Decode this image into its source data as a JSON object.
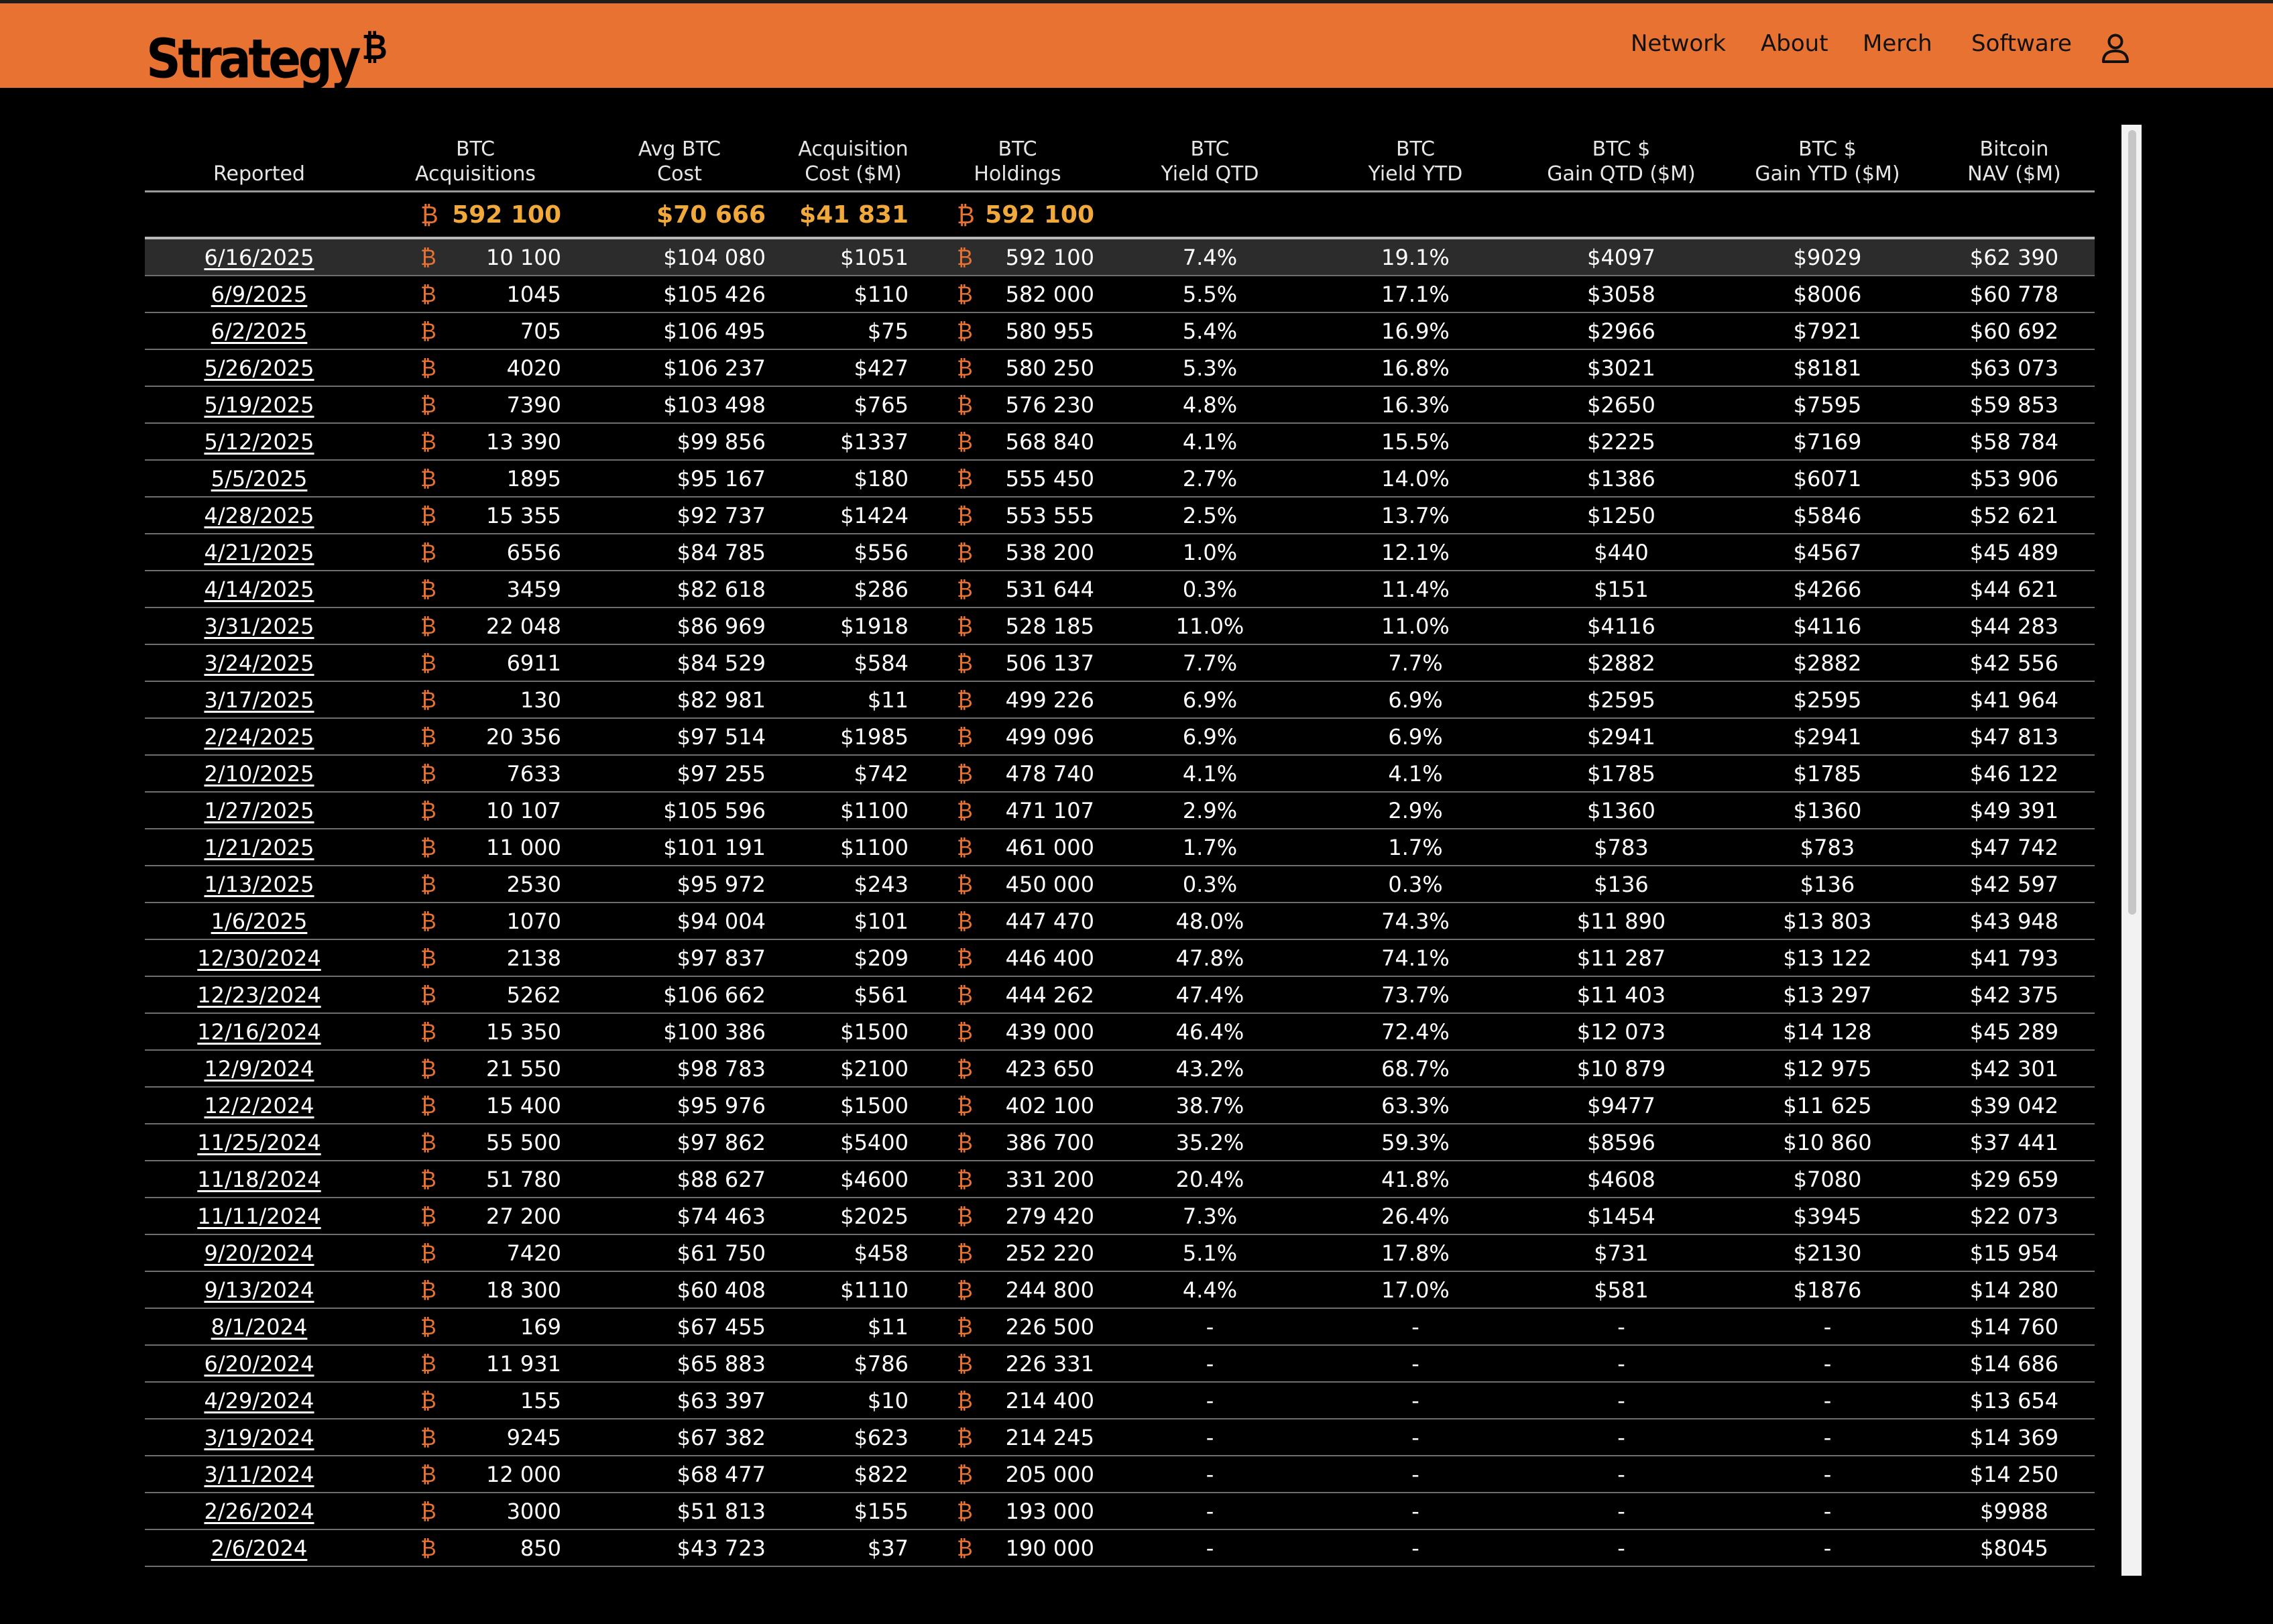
{
  "brand": {
    "name": "Strategy",
    "mark": "₿",
    "accent": "#E87232",
    "totals_color": "#F2A93B"
  },
  "nav": [
    "Network",
    "About",
    "Merch",
    "Software"
  ],
  "icons": {
    "user": "user-icon",
    "btc": "bitcoin-symbol"
  },
  "table": {
    "headers": [
      [
        "Reported"
      ],
      [
        "BTC",
        "Acquisitions"
      ],
      [
        "Avg BTC",
        "Cost"
      ],
      [
        "Acquisition",
        "Cost ($M)"
      ],
      [
        "BTC",
        "Holdings"
      ],
      [
        "BTC",
        "Yield QTD"
      ],
      [
        "BTC",
        "Yield YTD"
      ],
      [
        "BTC $",
        "Gain QTD ($M)"
      ],
      [
        "BTC $",
        "Gain YTD ($M)"
      ],
      [
        "Bitcoin",
        "NAV ($M)"
      ]
    ],
    "totals": {
      "acquisitions": "592 100",
      "avg_cost": "$70 666",
      "acq_cost": "$41 831",
      "holdings": "592 100"
    },
    "rows": [
      [
        "6/16/2025",
        "10 100",
        "$104 080",
        "$1051",
        "592 100",
        "7.4%",
        "19.1%",
        "$4097",
        "$9029",
        "$62 390"
      ],
      [
        "6/9/2025",
        "1045",
        "$105 426",
        "$110",
        "582 000",
        "5.5%",
        "17.1%",
        "$3058",
        "$8006",
        "$60 778"
      ],
      [
        "6/2/2025",
        "705",
        "$106 495",
        "$75",
        "580 955",
        "5.4%",
        "16.9%",
        "$2966",
        "$7921",
        "$60 692"
      ],
      [
        "5/26/2025",
        "4020",
        "$106 237",
        "$427",
        "580 250",
        "5.3%",
        "16.8%",
        "$3021",
        "$8181",
        "$63 073"
      ],
      [
        "5/19/2025",
        "7390",
        "$103 498",
        "$765",
        "576 230",
        "4.8%",
        "16.3%",
        "$2650",
        "$7595",
        "$59 853"
      ],
      [
        "5/12/2025",
        "13 390",
        "$99 856",
        "$1337",
        "568 840",
        "4.1%",
        "15.5%",
        "$2225",
        "$7169",
        "$58 784"
      ],
      [
        "5/5/2025",
        "1895",
        "$95 167",
        "$180",
        "555 450",
        "2.7%",
        "14.0%",
        "$1386",
        "$6071",
        "$53 906"
      ],
      [
        "4/28/2025",
        "15 355",
        "$92 737",
        "$1424",
        "553 555",
        "2.5%",
        "13.7%",
        "$1250",
        "$5846",
        "$52 621"
      ],
      [
        "4/21/2025",
        "6556",
        "$84 785",
        "$556",
        "538 200",
        "1.0%",
        "12.1%",
        "$440",
        "$4567",
        "$45 489"
      ],
      [
        "4/14/2025",
        "3459",
        "$82 618",
        "$286",
        "531 644",
        "0.3%",
        "11.4%",
        "$151",
        "$4266",
        "$44 621"
      ],
      [
        "3/31/2025",
        "22 048",
        "$86 969",
        "$1918",
        "528 185",
        "11.0%",
        "11.0%",
        "$4116",
        "$4116",
        "$44 283"
      ],
      [
        "3/24/2025",
        "6911",
        "$84 529",
        "$584",
        "506 137",
        "7.7%",
        "7.7%",
        "$2882",
        "$2882",
        "$42 556"
      ],
      [
        "3/17/2025",
        "130",
        "$82 981",
        "$11",
        "499 226",
        "6.9%",
        "6.9%",
        "$2595",
        "$2595",
        "$41 964"
      ],
      [
        "2/24/2025",
        "20 356",
        "$97 514",
        "$1985",
        "499 096",
        "6.9%",
        "6.9%",
        "$2941",
        "$2941",
        "$47 813"
      ],
      [
        "2/10/2025",
        "7633",
        "$97 255",
        "$742",
        "478 740",
        "4.1%",
        "4.1%",
        "$1785",
        "$1785",
        "$46 122"
      ],
      [
        "1/27/2025",
        "10 107",
        "$105 596",
        "$1100",
        "471 107",
        "2.9%",
        "2.9%",
        "$1360",
        "$1360",
        "$49 391"
      ],
      [
        "1/21/2025",
        "11 000",
        "$101 191",
        "$1100",
        "461 000",
        "1.7%",
        "1.7%",
        "$783",
        "$783",
        "$47 742"
      ],
      [
        "1/13/2025",
        "2530",
        "$95 972",
        "$243",
        "450 000",
        "0.3%",
        "0.3%",
        "$136",
        "$136",
        "$42 597"
      ],
      [
        "1/6/2025",
        "1070",
        "$94 004",
        "$101",
        "447 470",
        "48.0%",
        "74.3%",
        "$11 890",
        "$13 803",
        "$43 948"
      ],
      [
        "12/30/2024",
        "2138",
        "$97 837",
        "$209",
        "446 400",
        "47.8%",
        "74.1%",
        "$11 287",
        "$13 122",
        "$41 793"
      ],
      [
        "12/23/2024",
        "5262",
        "$106 662",
        "$561",
        "444 262",
        "47.4%",
        "73.7%",
        "$11 403",
        "$13 297",
        "$42 375"
      ],
      [
        "12/16/2024",
        "15 350",
        "$100 386",
        "$1500",
        "439 000",
        "46.4%",
        "72.4%",
        "$12 073",
        "$14 128",
        "$45 289"
      ],
      [
        "12/9/2024",
        "21 550",
        "$98 783",
        "$2100",
        "423 650",
        "43.2%",
        "68.7%",
        "$10 879",
        "$12 975",
        "$42 301"
      ],
      [
        "12/2/2024",
        "15 400",
        "$95 976",
        "$1500",
        "402 100",
        "38.7%",
        "63.3%",
        "$9477",
        "$11 625",
        "$39 042"
      ],
      [
        "11/25/2024",
        "55 500",
        "$97 862",
        "$5400",
        "386 700",
        "35.2%",
        "59.3%",
        "$8596",
        "$10 860",
        "$37 441"
      ],
      [
        "11/18/2024",
        "51 780",
        "$88 627",
        "$4600",
        "331 200",
        "20.4%",
        "41.8%",
        "$4608",
        "$7080",
        "$29 659"
      ],
      [
        "11/11/2024",
        "27 200",
        "$74 463",
        "$2025",
        "279 420",
        "7.3%",
        "26.4%",
        "$1454",
        "$3945",
        "$22 073"
      ],
      [
        "9/20/2024",
        "7420",
        "$61 750",
        "$458",
        "252 220",
        "5.1%",
        "17.8%",
        "$731",
        "$2130",
        "$15 954"
      ],
      [
        "9/13/2024",
        "18 300",
        "$60 408",
        "$1110",
        "244 800",
        "4.4%",
        "17.0%",
        "$581",
        "$1876",
        "$14 280"
      ],
      [
        "8/1/2024",
        "169",
        "$67 455",
        "$11",
        "226 500",
        "-",
        "-",
        "-",
        "-",
        "$14 760"
      ],
      [
        "6/20/2024",
        "11 931",
        "$65 883",
        "$786",
        "226 331",
        "-",
        "-",
        "-",
        "-",
        "$14 686"
      ],
      [
        "4/29/2024",
        "155",
        "$63 397",
        "$10",
        "214 400",
        "-",
        "-",
        "-",
        "-",
        "$13 654"
      ],
      [
        "3/19/2024",
        "9245",
        "$67 382",
        "$623",
        "214 245",
        "-",
        "-",
        "-",
        "-",
        "$14 369"
      ],
      [
        "3/11/2024",
        "12 000",
        "$68 477",
        "$822",
        "205 000",
        "-",
        "-",
        "-",
        "-",
        "$14 250"
      ],
      [
        "2/26/2024",
        "3000",
        "$51 813",
        "$155",
        "193 000",
        "-",
        "-",
        "-",
        "-",
        "$9988"
      ],
      [
        "2/6/2024",
        "850",
        "$43 723",
        "$37",
        "190 000",
        "-",
        "-",
        "-",
        "-",
        "$8045"
      ]
    ]
  }
}
